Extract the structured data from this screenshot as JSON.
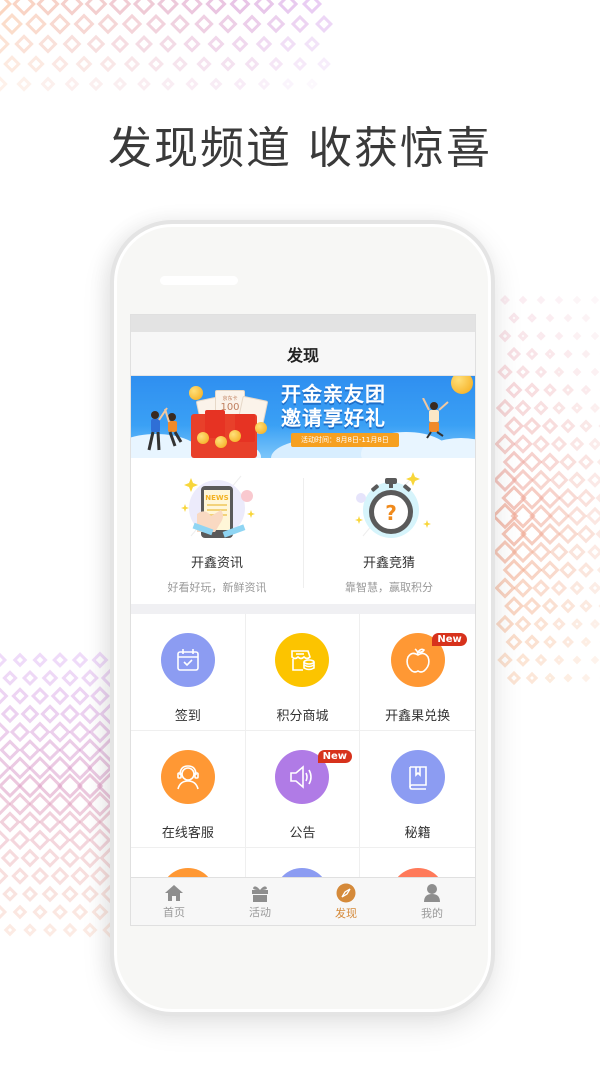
{
  "headline": "发现频道 收获惊喜",
  "screen": {
    "nav_title": "发现",
    "banner": {
      "title_line1": "开金亲友团",
      "title_line2": "邀请享好礼",
      "date_text": "活动时间：8月8日-11月8日",
      "ticket_amount": "100",
      "ticket_label": "京东卡"
    },
    "features": [
      {
        "title": "开鑫资讯",
        "subtitle": "好看好玩，新鲜资讯",
        "icon": "news-phone-icon",
        "icon_text": "NEWS"
      },
      {
        "title": "开鑫竞猜",
        "subtitle": "靠智慧，赢取积分",
        "icon": "stopwatch-question-icon",
        "icon_text": "?"
      }
    ],
    "grid": [
      {
        "label": "签到",
        "icon": "calendar-check-icon",
        "color": "#8c9cf2",
        "badge": null
      },
      {
        "label": "积分商城",
        "icon": "store-coins-icon",
        "color": "#fcc400",
        "badge": null
      },
      {
        "label": "开鑫果兑换",
        "icon": "apple-icon",
        "color": "#ff9834",
        "badge": "New"
      },
      {
        "label": "在线客服",
        "icon": "headset-agent-icon",
        "color": "#ff9834",
        "badge": null
      },
      {
        "label": "公告",
        "icon": "speaker-icon",
        "color": "#b07be6",
        "badge": "New"
      },
      {
        "label": "秘籍",
        "icon": "book-icon",
        "color": "#8c9cf2",
        "badge": null
      }
    ],
    "tabs": [
      {
        "label": "首页",
        "icon": "home-icon",
        "active": false
      },
      {
        "label": "活动",
        "icon": "gift-icon",
        "active": false
      },
      {
        "label": "发现",
        "icon": "compass-icon",
        "active": true
      },
      {
        "label": "我的",
        "icon": "user-icon",
        "active": false
      }
    ],
    "colors": {
      "accent": "#d58a3a",
      "badge": "#d7321c",
      "tab_inactive": "#9a9a9a"
    }
  }
}
